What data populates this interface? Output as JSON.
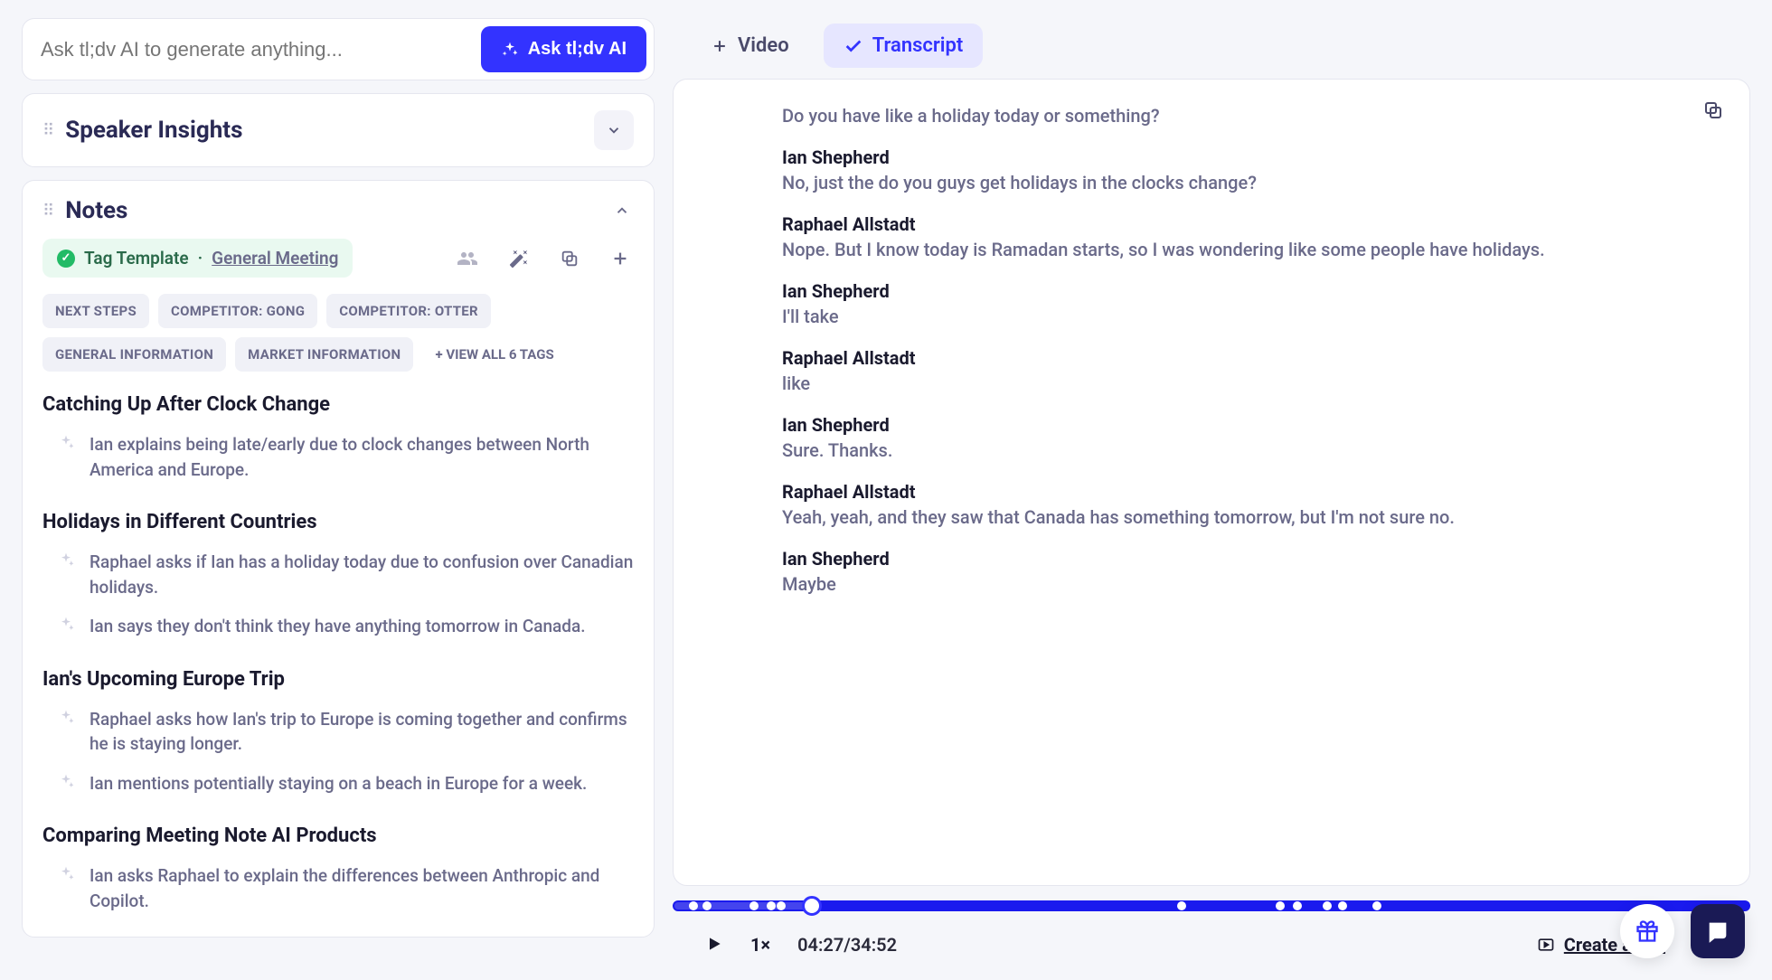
{
  "search": {
    "placeholder": "Ask tl;dv AI to generate anything...",
    "button": "Ask tl;dv AI"
  },
  "panels": {
    "speaker_insights_title": "Speaker Insights",
    "notes_title": "Notes"
  },
  "tag_template": {
    "label": "Tag Template",
    "separator": " · ",
    "link": "General Meeting"
  },
  "tags": [
    "NEXT STEPS",
    "COMPETITOR: GONG",
    "COMPETITOR: OTTER",
    "GENERAL INFORMATION",
    "MARKET INFORMATION"
  ],
  "view_all_tags": "+ VIEW ALL 6 TAGS",
  "notes": [
    {
      "title": "Catching Up After Clock Change",
      "items": [
        "Ian explains being late/early due to clock changes between North America and Europe."
      ]
    },
    {
      "title": "Holidays in Different Countries",
      "items": [
        "Raphael asks if Ian has a holiday today due to confusion over Canadian holidays.",
        "Ian says they don't think they have anything tomorrow in Canada."
      ]
    },
    {
      "title": "Ian's Upcoming Europe Trip",
      "items": [
        "Raphael asks how Ian's trip to Europe is coming together and confirms he is staying longer.",
        "Ian mentions potentially staying on a beach in Europe for a week."
      ]
    },
    {
      "title": "Comparing Meeting Note AI Products",
      "items": [
        "Ian asks Raphael to explain the differences between Anthropic and Copilot."
      ]
    }
  ],
  "tabs": {
    "video": "Video",
    "transcript": "Transcript"
  },
  "transcript": [
    {
      "speaker": "",
      "text": "Do you have like a holiday today or something?"
    },
    {
      "speaker": "Ian Shepherd",
      "text": "No, just the do you guys get holidays in the clocks change?"
    },
    {
      "speaker": "Raphael Allstadt",
      "text": "Nope. But I know today is Ramadan starts, so I was wondering like some people have holidays."
    },
    {
      "speaker": "Ian Shepherd",
      "text": "I'll take"
    },
    {
      "speaker": "Raphael Allstadt",
      "text": "like"
    },
    {
      "speaker": "Ian Shepherd",
      "text": "Sure. Thanks."
    },
    {
      "speaker": "Raphael Allstadt",
      "text": "Yeah, yeah, and they saw that Canada has something tomorrow, but I'm not sure no."
    },
    {
      "speaker": "Ian Shepherd",
      "text": "Maybe"
    }
  ],
  "player": {
    "speed": "1×",
    "current": "04:27",
    "sep": "/",
    "total": "34:52",
    "create_clip": "Create a clip",
    "thumb_pct": 12.8,
    "markers_pct": [
      1.8,
      3.0,
      7.4,
      9.0,
      9.9,
      47.2,
      56.4,
      58.0,
      60.8,
      62.2,
      65.4
    ]
  }
}
